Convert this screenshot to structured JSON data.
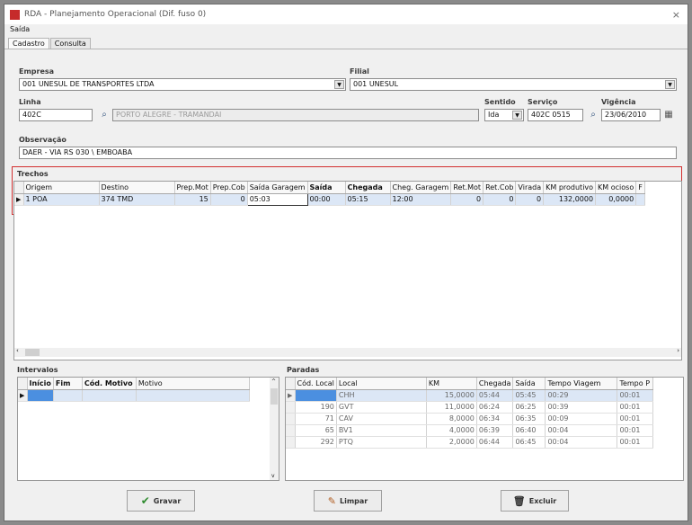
{
  "window": {
    "title": "RDA - Planejamento Operacional (Dif. fuso 0)",
    "close": "×"
  },
  "menu": {
    "saida": "Saída"
  },
  "tabs": [
    {
      "label": "Cadastro"
    },
    {
      "label": "Consulta"
    }
  ],
  "form": {
    "empresa_label": "Empresa",
    "empresa_value": "001 UNESUL DE TRANSPORTES LTDA",
    "filial_label": "Filial",
    "filial_value": "001 UNESUL",
    "linha_label": "Linha",
    "linha_value": "402C",
    "linha_desc": "PORTO ALEGRE - TRAMANDAI",
    "sentido_label": "Sentido",
    "sentido_value": "Ida",
    "servico_label": "Serviço",
    "servico_value": "402C 0515",
    "vigencia_label": "Vigência",
    "vigencia_value": "23/06/2010",
    "observacao_label": "Observação",
    "observacao_value": "DAER - VIA RS 030 \\ EMBOABA"
  },
  "trechos": {
    "title": "Trechos",
    "columns": [
      "Origem",
      "Destino",
      "Prep.Mot",
      "Prep.Cob",
      "Saída Garagem",
      "Saída",
      "Chegada",
      "Cheg. Garagem",
      "Ret.Mot",
      "Ret.Cob",
      "Virada",
      "KM produtivo",
      "KM ocioso",
      "F"
    ],
    "row": {
      "origem": "1 POA",
      "destino": "374 TMD",
      "prep_mot": "15",
      "prep_cob": "0",
      "saida_garagem": "05:03",
      "saida": "00:00",
      "chegada": "05:15",
      "cheg_garagem": "12:00",
      "ret_mot": "0",
      "ret_cob": "0",
      "virada": "0",
      "km_produtivo": "132,0000",
      "km_ocioso": "0,0000"
    }
  },
  "intervalos": {
    "title": "Intervalos",
    "columns": [
      "Início",
      "Fim",
      "Cód. Motivo",
      "Motivo"
    ]
  },
  "paradas": {
    "title": "Paradas",
    "columns": [
      "Cód. Local",
      "Local",
      "KM",
      "Chegada",
      "Saída",
      "Tempo Viagem",
      "Tempo P"
    ],
    "rows": [
      {
        "cod": "",
        "local": "CHH",
        "km": "15,0000",
        "chegada": "05:44",
        "saida": "05:45",
        "tempo": "00:29",
        "tempo_p": "00:01"
      },
      {
        "cod": "190",
        "local": "GVT",
        "km": "11,0000",
        "chegada": "06:24",
        "saida": "06:25",
        "tempo": "00:39",
        "tempo_p": "00:01"
      },
      {
        "cod": "71",
        "local": "CAV",
        "km": "8,0000",
        "chegada": "06:34",
        "saida": "06:35",
        "tempo": "00:09",
        "tempo_p": "00:01"
      },
      {
        "cod": "65",
        "local": "BV1",
        "km": "4,0000",
        "chegada": "06:39",
        "saida": "06:40",
        "tempo": "00:04",
        "tempo_p": "00:01"
      },
      {
        "cod": "292",
        "local": "PTQ",
        "km": "2,0000",
        "chegada": "06:44",
        "saida": "06:45",
        "tempo": "00:04",
        "tempo_p": "00:01"
      }
    ]
  },
  "buttons": {
    "gravar": "Gravar",
    "limpar": "Limpar",
    "excluir": "Excluir"
  },
  "colors": {
    "highlight": "#d23030",
    "selected_row": "#dce7f6"
  }
}
